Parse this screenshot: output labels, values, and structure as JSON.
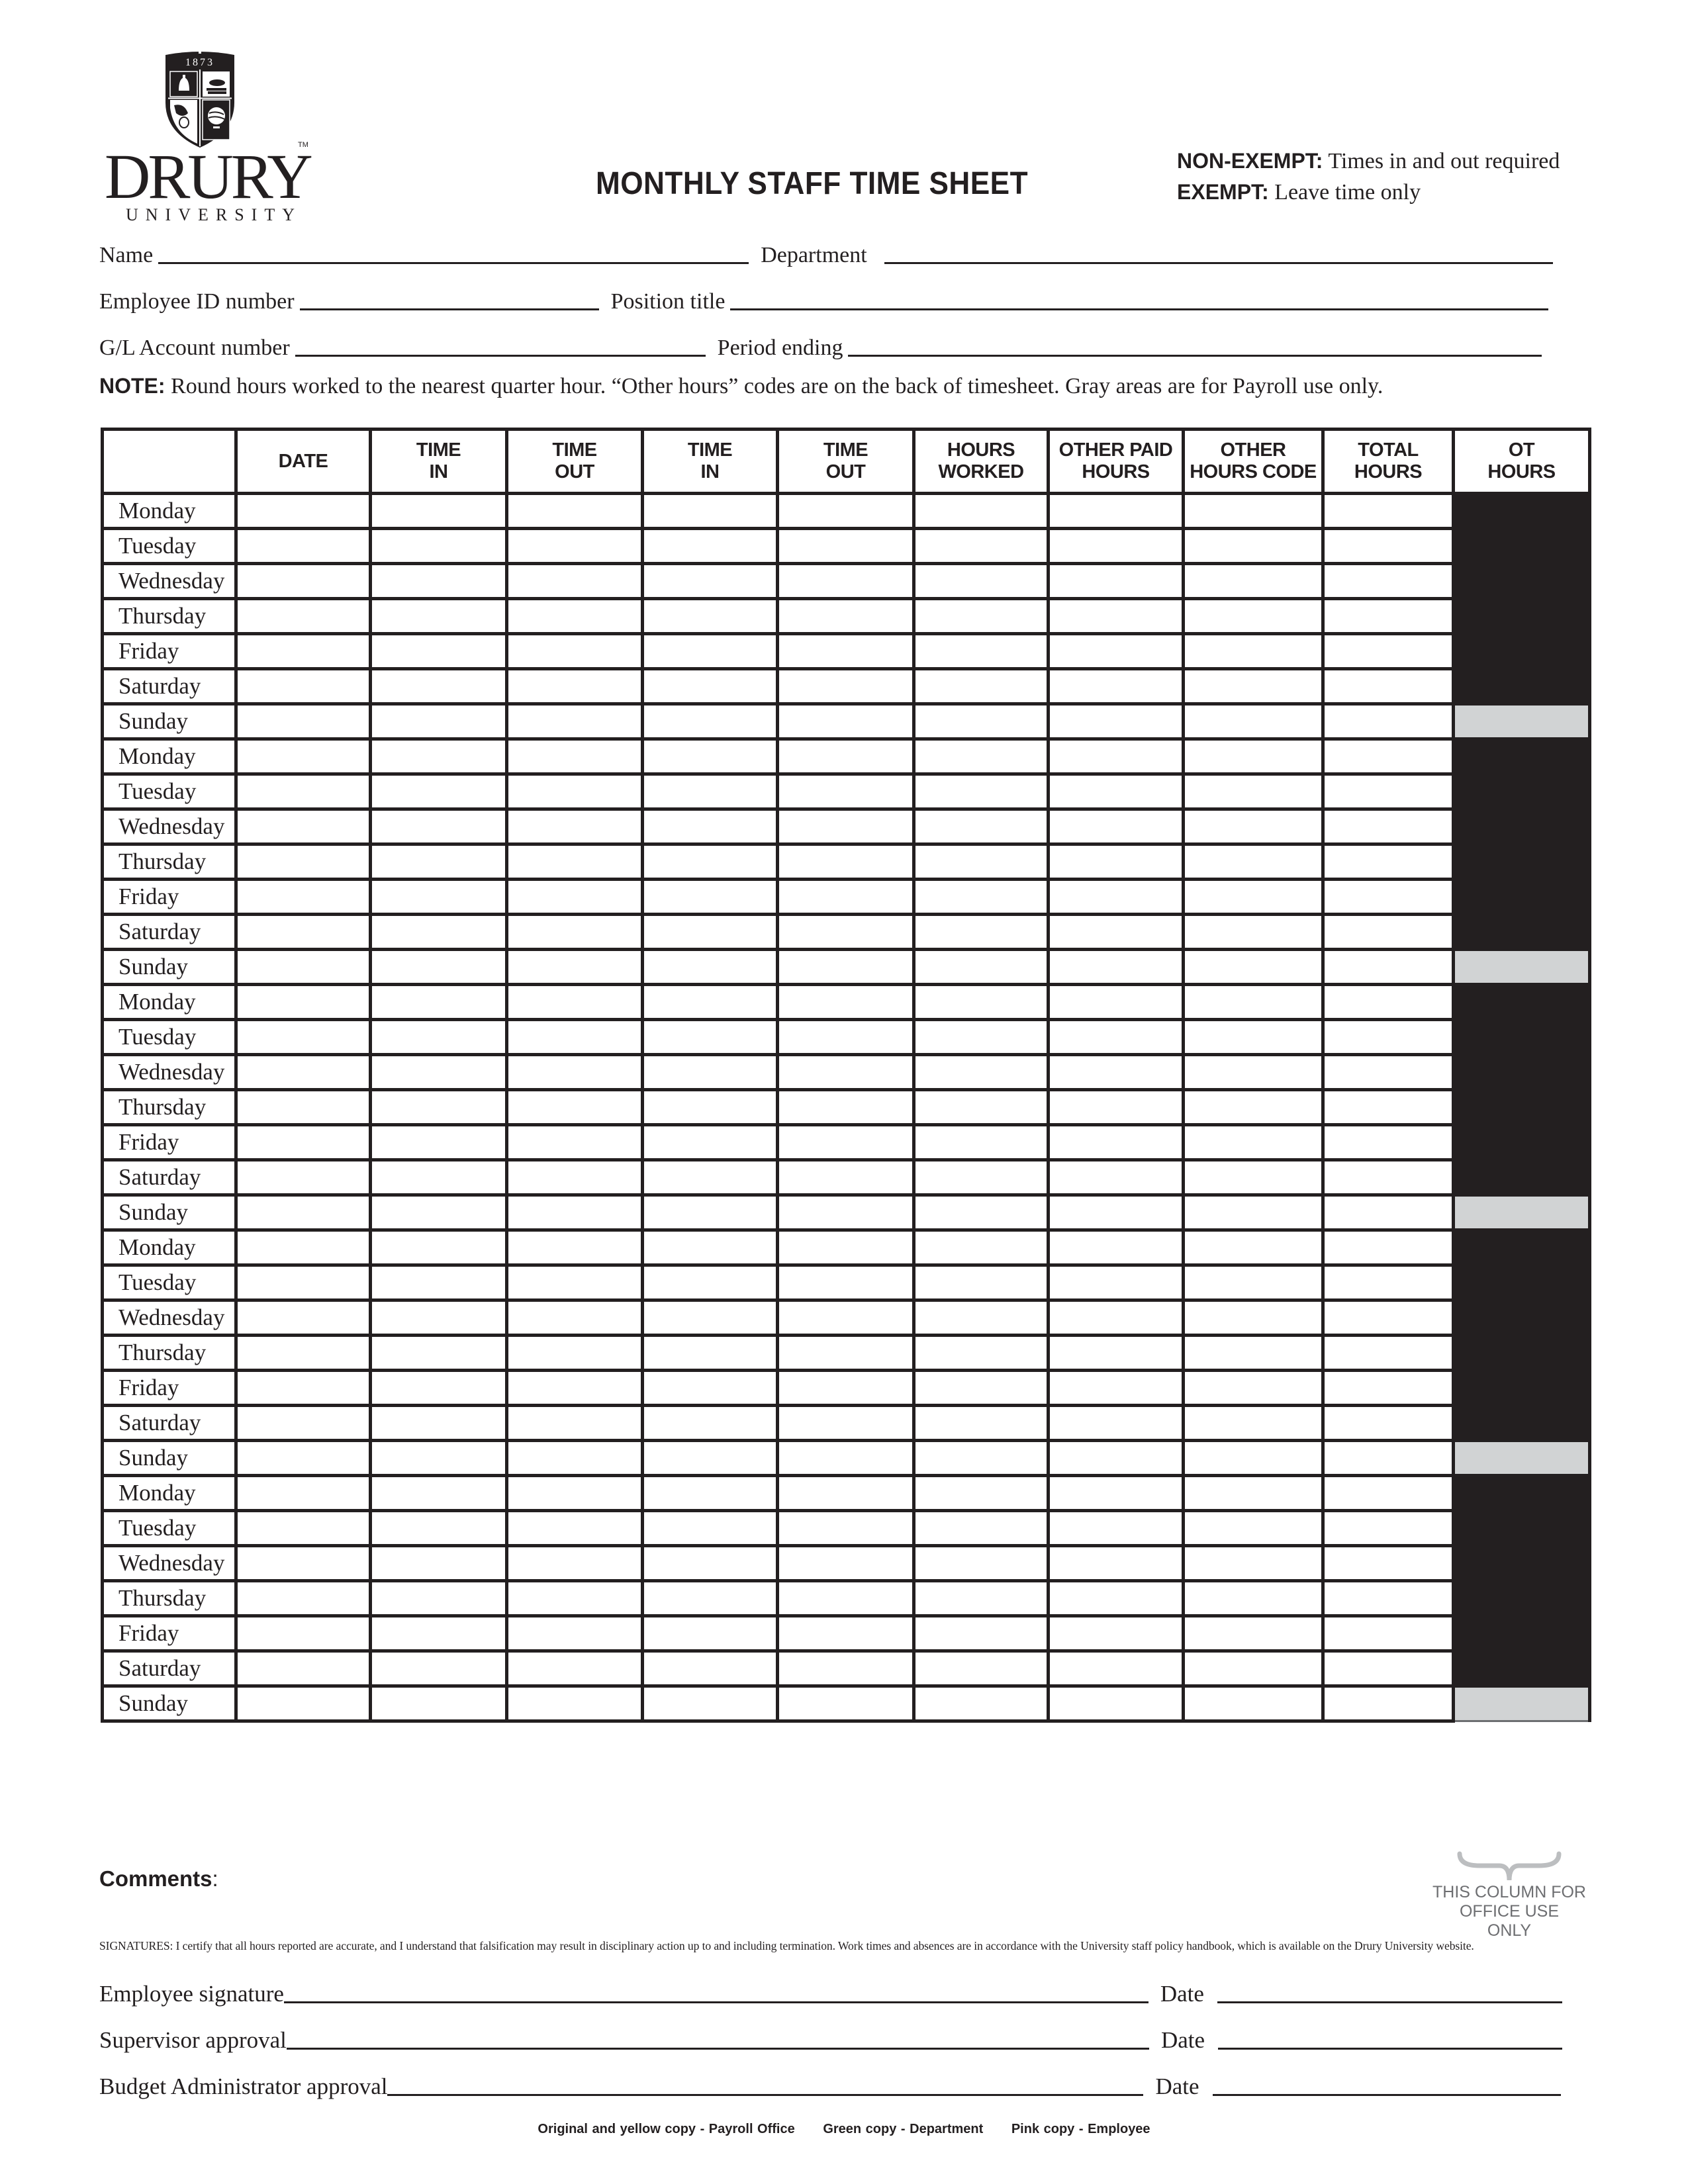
{
  "logo": {
    "year": "1873",
    "wordmark": "DRURY",
    "subtitle": "UNIVERSITY",
    "trademark": "TM"
  },
  "title": "MONTHLY STAFF TIME SHEET",
  "exempt_notes": [
    {
      "label": "NON-EXEMPT:",
      "text": " Times in and out required"
    },
    {
      "label": "EXEMPT:",
      "text": " Leave time only"
    }
  ],
  "fields": {
    "name": {
      "label": "Name",
      "value": ""
    },
    "department": {
      "label": "Department",
      "value": ""
    },
    "employee_id": {
      "label": "Employee ID number",
      "value": ""
    },
    "position_title": {
      "label": "Position title",
      "value": ""
    },
    "gl_account": {
      "label": "G/L Account number",
      "value": ""
    },
    "period_ending": {
      "label": "Period ending",
      "value": ""
    }
  },
  "note": {
    "label": "NOTE:",
    "text": " Round hours worked to the nearest quarter hour. “Other hours” codes are on the back of timesheet. Gray areas are for Payroll use only."
  },
  "table": {
    "columns": [
      {
        "line1": "",
        "line2": ""
      },
      {
        "line1": "DATE",
        "line2": ""
      },
      {
        "line1": "TIME",
        "line2": "IN"
      },
      {
        "line1": "TIME",
        "line2": "OUT"
      },
      {
        "line1": "TIME",
        "line2": "IN"
      },
      {
        "line1": "TIME",
        "line2": "OUT"
      },
      {
        "line1": "HOURS",
        "line2": "WORKED"
      },
      {
        "line1": "OTHER PAID",
        "line2": "HOURS"
      },
      {
        "line1": "OTHER",
        "line2": "HOURS CODE"
      },
      {
        "line1": "TOTAL",
        "line2": "HOURS"
      },
      {
        "line1": "OT",
        "line2": "HOURS"
      }
    ],
    "days": [
      "Monday",
      "Tuesday",
      "Wednesday",
      "Thursday",
      "Friday",
      "Saturday",
      "Sunday",
      "Monday",
      "Tuesday",
      "Wednesday",
      "Thursday",
      "Friday",
      "Saturday",
      "Sunday",
      "Monday",
      "Tuesday",
      "Wednesday",
      "Thursday",
      "Friday",
      "Saturday",
      "Sunday",
      "Monday",
      "Tuesday",
      "Wednesday",
      "Thursday",
      "Friday",
      "Saturday",
      "Sunday",
      "Monday",
      "Tuesday",
      "Wednesday",
      "Thursday",
      "Friday",
      "Saturday",
      "Sunday"
    ],
    "office_use_note": [
      "THIS COLUMN FOR",
      "OFFICE USE",
      "ONLY"
    ]
  },
  "colors": {
    "ink": "#231f20",
    "payroll_gray": "#d1d3d4",
    "note_gray": "#6d6e71",
    "brace_gray": "#bcbec0"
  },
  "comments": {
    "label": "Comments",
    "colon": ":",
    "value": ""
  },
  "disclaimer": "SIGNATURES: I certify that all hours reported are accurate, and I understand that falsification may result in disciplinary action up to and including termination. Work times and absences are in accordance with the University staff policy handbook, which is available on the Drury University website.",
  "signatures": [
    {
      "label": "Employee signature",
      "date_label": "Date"
    },
    {
      "label": "Supervisor approval",
      "date_label": "Date"
    },
    {
      "label": "Budget Administrator approval",
      "date_label": "Date"
    }
  ],
  "footer": [
    "Original and yellow copy - Payroll Office",
    "Green copy - Department",
    "Pink copy - Employee"
  ]
}
